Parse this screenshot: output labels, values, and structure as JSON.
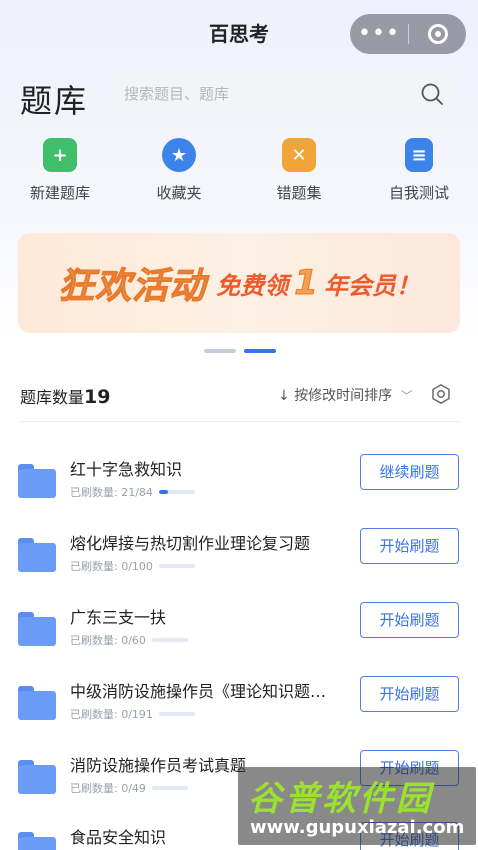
{
  "nav": {
    "title": "百思考",
    "more": "•••"
  },
  "page_title": "题库",
  "search": {
    "placeholder": "搜索题目、题库",
    "value": ""
  },
  "quick_actions": [
    {
      "label": "新建题库",
      "icon": "plus-icon",
      "color": "#3fbf6a",
      "glyph": "+"
    },
    {
      "label": "收藏夹",
      "icon": "star-icon",
      "color": "#3d84ea",
      "glyph": "★"
    },
    {
      "label": "错题集",
      "icon": "cross-icon",
      "color": "#f1a43a",
      "glyph": "✕"
    },
    {
      "label": "自我测试",
      "icon": "document-icon",
      "color": "#3d84ea",
      "glyph": "≡"
    }
  ],
  "banner": {
    "main": "狂欢活动",
    "sub_before": "免费领",
    "sub_num": "1",
    "sub_after": "年会员！"
  },
  "list_header": {
    "count_label": "题库数量",
    "count": "19",
    "sort_label": "按修改时间排序",
    "sort_arrow": "↓",
    "sort_chevron": "﹀"
  },
  "banks": [
    {
      "name": "红十字急救知识",
      "progress_text": "已刷数量: 21/84",
      "progress": 0.25,
      "button": "继续刷题"
    },
    {
      "name": "熔化焊接与热切割作业理论复习题",
      "progress_text": "已刷数量: 0/100",
      "progress": 0,
      "button": "开始刷题"
    },
    {
      "name": "广东三支一扶",
      "progress_text": "已刷数量: 0/60",
      "progress": 0,
      "button": "开始刷题"
    },
    {
      "name": "中级消防设施操作员《理论知识题…",
      "progress_text": "已刷数量: 0/191",
      "progress": 0,
      "button": "开始刷题"
    },
    {
      "name": "消防设施操作员考试真题",
      "progress_text": "已刷数量: 0/49",
      "progress": 0,
      "button": "开始刷题"
    },
    {
      "name": "食品安全知识",
      "progress_text": "",
      "progress": 0,
      "button": "开始刷题"
    }
  ],
  "watermark": {
    "top": "谷普软件园",
    "bottom": "www.gupuxiazai.com"
  },
  "colors": {
    "accent": "#3b72e6",
    "folder": "#6b9cf5",
    "capsule": "#9a9aa6"
  }
}
